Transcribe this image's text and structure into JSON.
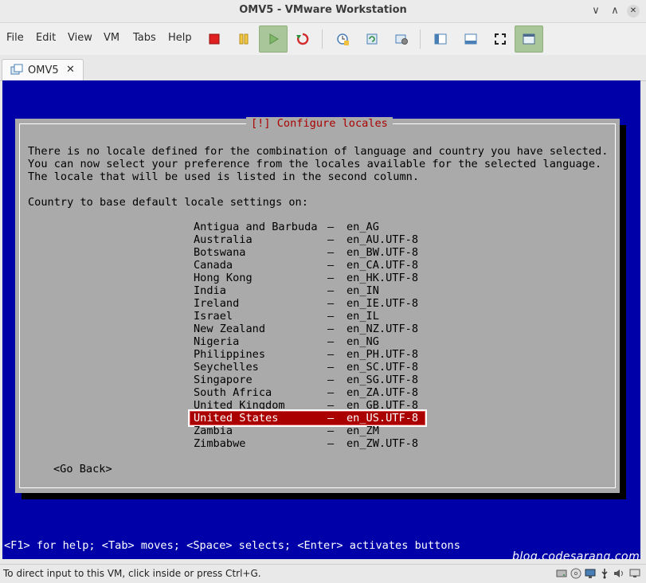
{
  "window": {
    "title": "OMV5 - VMware Workstation",
    "minimize_glyph": "∨",
    "maximize_glyph": "∧",
    "close_glyph": "✕"
  },
  "menu": {
    "items": [
      "File",
      "Edit",
      "View",
      "VM",
      "Tabs",
      "Help"
    ]
  },
  "toolbar": {
    "icons": [
      "suspend-red-square-icon",
      "pause-icon",
      "play-icon",
      "restart-icon",
      "snapshot-icon",
      "revert-snapshot-icon",
      "manage-snapshots-icon",
      "sidebar-icon",
      "console-view-icon",
      "fullscreen-icon",
      "unity-icon"
    ]
  },
  "tab": {
    "label": "OMV5",
    "close_glyph": "✕"
  },
  "console": {
    "dialog_title": "[!] Configure locales",
    "body_lines": [
      "There is no locale defined for the combination of language and country you have selected.",
      "You can now select your preference from the locales available for the selected language.",
      "The locale that will be used is listed in the second column."
    ],
    "prompt": "Country to base default locale settings on:",
    "dash": "–",
    "locales": [
      {
        "country": "Antigua and Barbuda",
        "locale": "en_AG"
      },
      {
        "country": "Australia",
        "locale": "en_AU.UTF-8"
      },
      {
        "country": "Botswana",
        "locale": "en_BW.UTF-8"
      },
      {
        "country": "Canada",
        "locale": "en_CA.UTF-8"
      },
      {
        "country": "Hong Kong",
        "locale": "en_HK.UTF-8"
      },
      {
        "country": "India",
        "locale": "en_IN"
      },
      {
        "country": "Ireland",
        "locale": "en_IE.UTF-8"
      },
      {
        "country": "Israel",
        "locale": "en_IL"
      },
      {
        "country": "New Zealand",
        "locale": "en_NZ.UTF-8"
      },
      {
        "country": "Nigeria",
        "locale": "en_NG"
      },
      {
        "country": "Philippines",
        "locale": "en_PH.UTF-8"
      },
      {
        "country": "Seychelles",
        "locale": "en_SC.UTF-8"
      },
      {
        "country": "Singapore",
        "locale": "en_SG.UTF-8"
      },
      {
        "country": "South Africa",
        "locale": "en_ZA.UTF-8"
      },
      {
        "country": "United Kingdom",
        "locale": "en_GB.UTF-8"
      },
      {
        "country": "United States",
        "locale": "en_US.UTF-8",
        "selected": true
      },
      {
        "country": "Zambia",
        "locale": "en_ZM"
      },
      {
        "country": "Zimbabwe",
        "locale": "en_ZW.UTF-8"
      }
    ],
    "go_back": "<Go Back>",
    "help_line": "<F1> for help; <Tab> moves; <Space> selects; <Enter> activates buttons",
    "watermark": "blog.codesarang.com"
  },
  "status": {
    "message": "To direct input to this VM, click inside or press Ctrl+G."
  },
  "colors": {
    "console_bg": "#0000a8",
    "dialog_bg": "#aaaaaa",
    "title_red": "#aa0000",
    "selection_bg": "#aa0000"
  }
}
